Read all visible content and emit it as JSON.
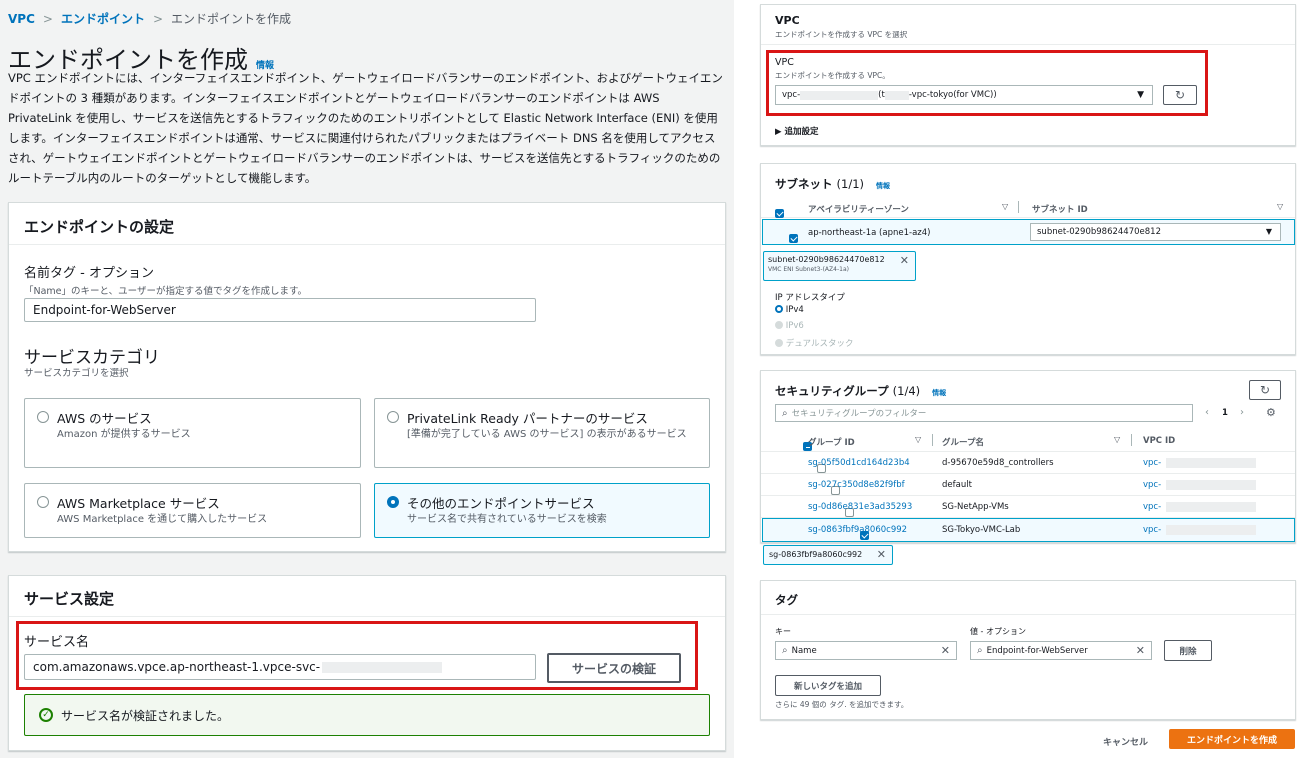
{
  "breadcrumb": {
    "vpc": "VPC",
    "sep": ">",
    "endpoints": "エンドポイント",
    "current": "エンドポイントを作成"
  },
  "page": {
    "title": "エンドポイントを作成",
    "info": "情報",
    "description": "VPC エンドポイントには、インターフェイスエンドポイント、ゲートウェイロードバランサーのエンドポイント、およびゲートウェイエンドポイントの 3 種類があります。インターフェイスエンドポイントとゲートウェイロードバランサーのエンドポイントは AWS PrivateLink を使用し、サービスを送信先とするトラフィックのためのエントリポイントとして Elastic Network Interface (ENI) を使用します。インターフェイスエンドポイントは通常、サービスに関連付けられたパブリックまたはプライベート DNS 名を使用してアクセスされ、ゲートウェイエンドポイントとゲートウェイロードバランサーのエンドポイントは、サービスを送信先とするトラフィックのためのルートテーブル内のルートのターゲットとして機能します。"
  },
  "endpoint_settings": {
    "title": "エンドポイントの設定",
    "name_label": "名前タグ - オプション",
    "name_desc": "「Name」のキーと、ユーザーが指定する値でタグを作成します。",
    "name_value": "Endpoint-for-WebServer",
    "category_title": "サービスカテゴリ",
    "category_desc": "サービスカテゴリを選択",
    "tiles": [
      {
        "title": "AWS のサービス",
        "sub": "Amazon が提供するサービス",
        "selected": false
      },
      {
        "title": "PrivateLink Ready パートナーのサービス",
        "sub": "[準備が完了している AWS のサービス] の表示があるサービス",
        "selected": false
      },
      {
        "title": "AWS Marketplace サービス",
        "sub": "AWS Marketplace を通じて購入したサービス",
        "selected": false
      },
      {
        "title": "その他のエンドポイントサービス",
        "sub": "サービス名で共有されているサービスを検索",
        "selected": true
      }
    ]
  },
  "service_settings": {
    "title": "サービス設定",
    "name_label": "サービス名",
    "name_value": "com.amazonaws.vpce.ap-northeast-1.vpce-svc-",
    "verify_button": "サービスの検証",
    "success": "サービス名が検証されました。"
  },
  "vpc_panel": {
    "title": "VPC",
    "desc": "エンドポイントを作成する VPC を選択",
    "field_label": "VPC",
    "field_desc": "エンドポイントを作成する VPC。",
    "value_a": "vpc-",
    "value_b": "(t",
    "value_c": "-vpc-tokyo(for VMC))",
    "advanced": "追加設定"
  },
  "subnet_panel": {
    "title": "サブネット",
    "count": "(1/1)",
    "info": "情報",
    "col_az": "アベイラビリティーゾーン",
    "col_subnet": "サブネット ID",
    "row_az": "ap-northeast-1a (apne1-az4)",
    "row_subnet": "subnet-0290b98624470e812",
    "token_id": "subnet-0290b98624470e812",
    "token_desc": "VMC ENI Subnet3-(AZ4-1a)",
    "ip_type_label": "IP アドレスタイプ",
    "ip_options": [
      "IPv4",
      "IPv6",
      "デュアルスタック"
    ]
  },
  "sg_panel": {
    "title": "セキュリティグループ",
    "count": "(1/4)",
    "info": "情報",
    "filter_placeholder": "セキュリティグループのフィルター",
    "page": "1",
    "col_id": "グループ ID",
    "col_name": "グループ名",
    "col_vpc": "VPC ID",
    "rows": [
      {
        "id": "sg-05f50d1cd164d23b4",
        "name": "d-95670e59d8_controllers",
        "vpc": "vpc-",
        "checked": false
      },
      {
        "id": "sg-027c350d8e82f9fbf",
        "name": "default",
        "vpc": "vpc-",
        "checked": false
      },
      {
        "id": "sg-0d86e831e3ad35293",
        "name": "SG-NetApp-VMs",
        "vpc": "vpc-",
        "checked": false
      },
      {
        "id": "sg-0863fbf9a8060c992",
        "name": "SG-Tokyo-VMC-Lab",
        "vpc": "vpc-",
        "checked": true
      }
    ],
    "token": "sg-0863fbf9a8060c992"
  },
  "tags_panel": {
    "title": "タグ",
    "key_label": "キー",
    "value_label": "値 - オプション",
    "key_value": "Name",
    "value_value": "Endpoint-for-WebServer",
    "remove": "削除",
    "add": "新しいタグを追加",
    "remaining": "さらに 49 個の タグ. を追加できます。"
  },
  "footer": {
    "cancel": "キャンセル",
    "create": "エンドポイントを作成"
  },
  "colors": {
    "accent": "#0073bb",
    "orange": "#ec7211",
    "highlight": "#d91515",
    "success": "#1d8102"
  }
}
